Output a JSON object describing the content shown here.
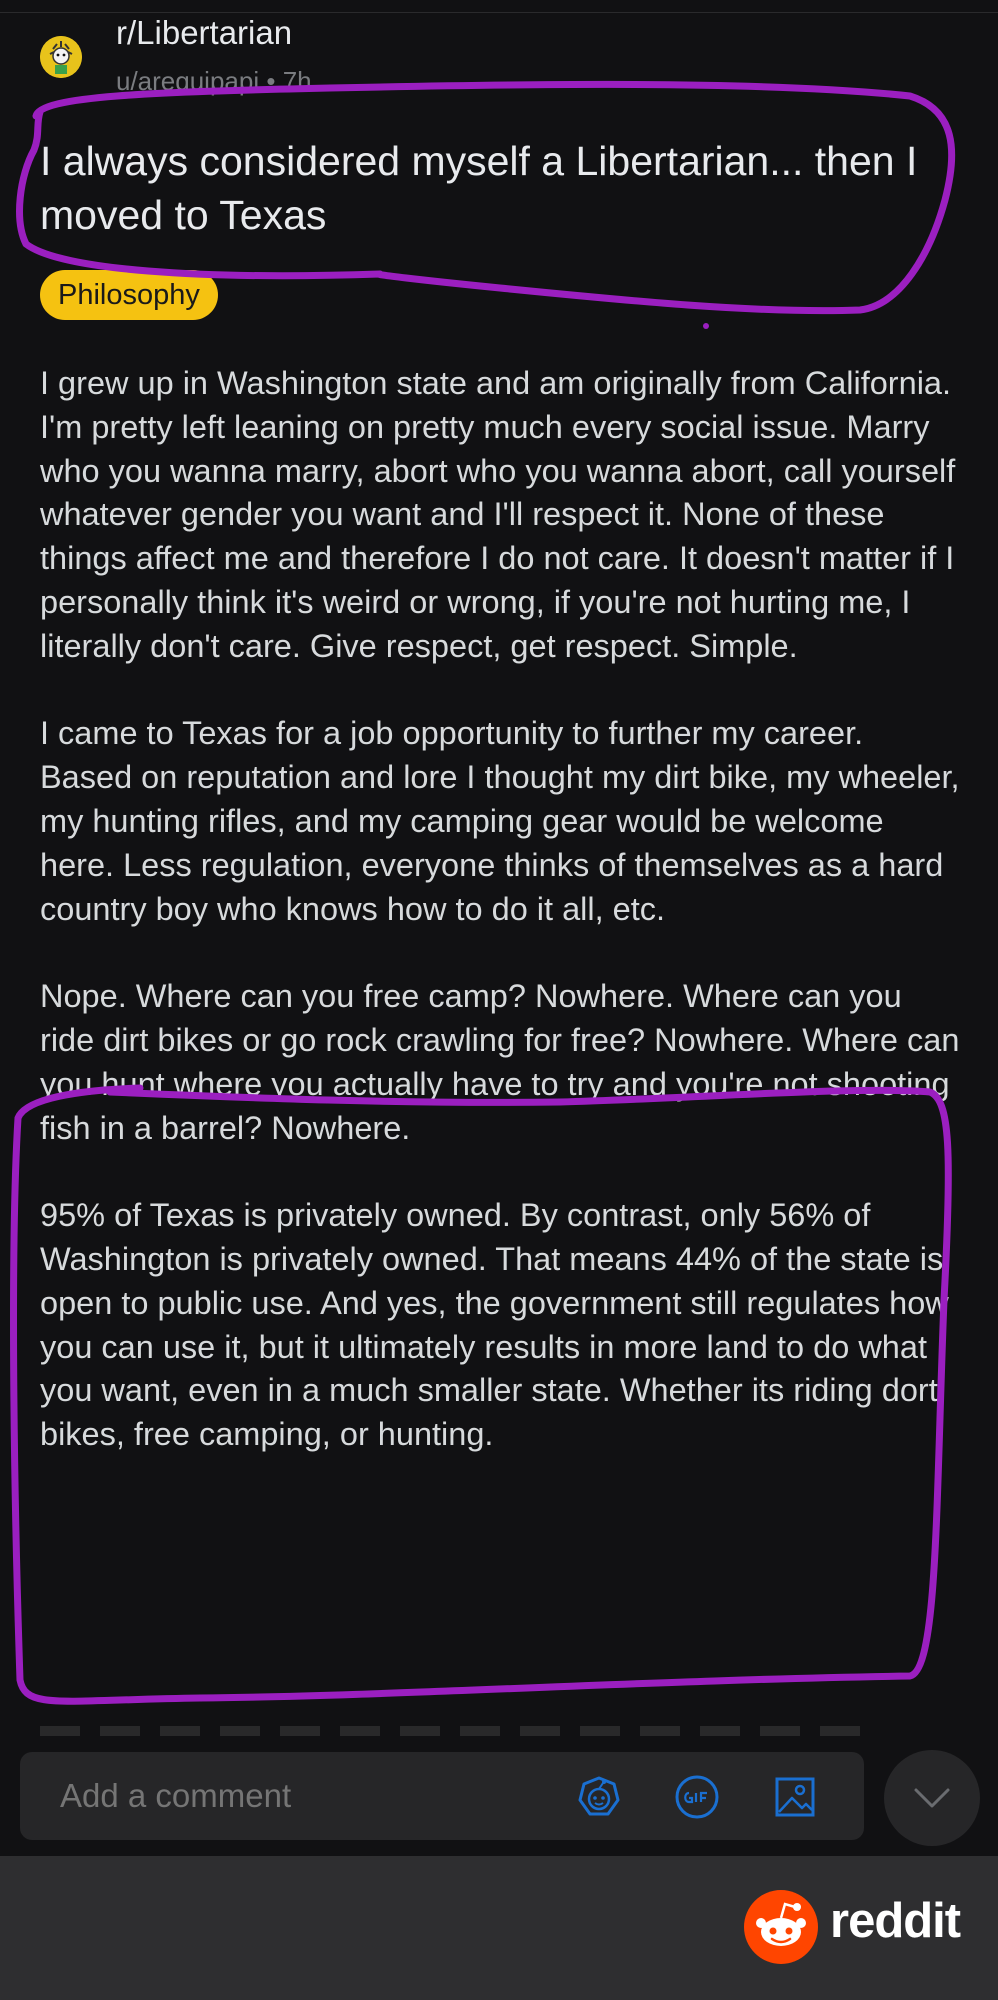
{
  "post": {
    "subreddit": "r/Libertarian",
    "author": "u/arequipapi",
    "age": "7h",
    "title": "I always considered myself a Libertarian... then I moved to Texas",
    "flair": "Philosophy",
    "paragraphs": [
      "I grew up in Washington state and am originally from California. I'm pretty left leaning on pretty much every social issue. Marry who you wanna marry, abort who you wanna abort, call yourself whatever gender you want and I'll respect it. None of these things affect me and therefore I do not care. It doesn't matter if I personally think it's weird or wrong,  if you're not hurting me, I literally don't care. Give respect, get respect. Simple.",
      "I came to Texas for a job opportunity to further my career. Based on reputation and lore I thought my dirt bike, my wheeler, my hunting rifles, and my camping gear would be welcome here. Less regulation, everyone thinks of themselves as a hard country boy who knows how to do it all, etc.",
      "Nope. Where can you free camp? Nowhere. Where can you ride dirt bikes or go rock crawling for free? Nowhere. Where can you hunt where you actually have to try and you're not shooting fish in a barrel? Nowhere.",
      "95% of Texas is privately owned. By contrast,  only 56% of Washington is privately owned. That means 44% of the state is open to public use. And yes, the government still regulates how you can use it, but it ultimately results in more land to do what you want, even in a much smaller state. Whether its riding dort bikes, free camping, or hunting."
    ]
  },
  "composer": {
    "placeholder": "Add a comment",
    "icons": [
      "snoo-emoji-icon",
      "gif-icon",
      "image-icon"
    ],
    "collapse_icon": "chevron-down-icon"
  },
  "footer": {
    "brand": "reddit"
  },
  "colors": {
    "background": "#111113",
    "flair": "#f5c211",
    "annotation": "#9b1fc0",
    "reddit_orange": "#ff4500",
    "composer_icon": "#1a6fd1"
  }
}
